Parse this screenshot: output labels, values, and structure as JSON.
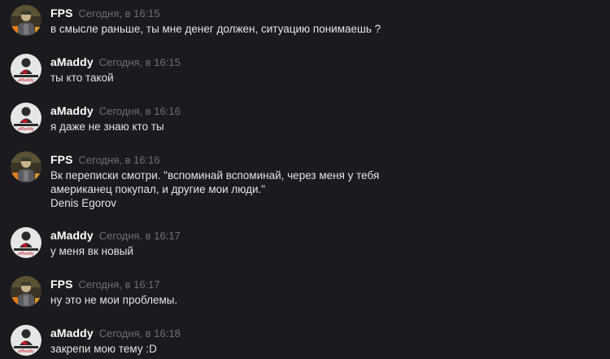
{
  "messages": [
    {
      "author": "FPS",
      "avatar_icon": "soldier-avatar",
      "time": "Сегодня, в 16:15",
      "lines": [
        "в смысле раньше, ты мне денег должен, ситуацию понимаешь ?"
      ]
    },
    {
      "author": "aMaddy",
      "avatar_icon": "person-logo-avatar",
      "avatar_caption": "aMaddy",
      "time": "Сегодня, в 16:15",
      "lines": [
        "ты кто такой"
      ]
    },
    {
      "author": "aMaddy",
      "avatar_icon": "person-logo-avatar",
      "avatar_caption": "aMaddy",
      "time": "Сегодня, в 16:16",
      "lines": [
        "я даже не знаю кто ты"
      ]
    },
    {
      "author": "FPS",
      "avatar_icon": "soldier-avatar",
      "time": "Сегодня, в 16:16",
      "lines": [
        "Вк переписки смотри. \"вспоминай вспоминай, через меня у тебя",
        "американец покупал, и другие мои люди.\"",
        "Denis Egorov"
      ]
    },
    {
      "author": "aMaddy",
      "avatar_icon": "person-logo-avatar",
      "avatar_caption": "aMaddy",
      "time": "Сегодня, в 16:17",
      "lines": [
        "у меня вк новый"
      ]
    },
    {
      "author": "FPS",
      "avatar_icon": "soldier-avatar",
      "time": "Сегодня, в 16:17",
      "lines": [
        "ну это не мои проблемы."
      ]
    },
    {
      "author": "aMaddy",
      "avatar_icon": "person-logo-avatar",
      "avatar_caption": "aMaddy",
      "time": "Сегодня, в 16:18",
      "lines": [
        "закрепи мою тему :D"
      ]
    }
  ],
  "colors": {
    "background": "#1b1b1f",
    "username": "#ffffff",
    "timestamp": "#6c6f75",
    "message_text": "#e3e4e6",
    "logo_red": "#c8141e"
  }
}
